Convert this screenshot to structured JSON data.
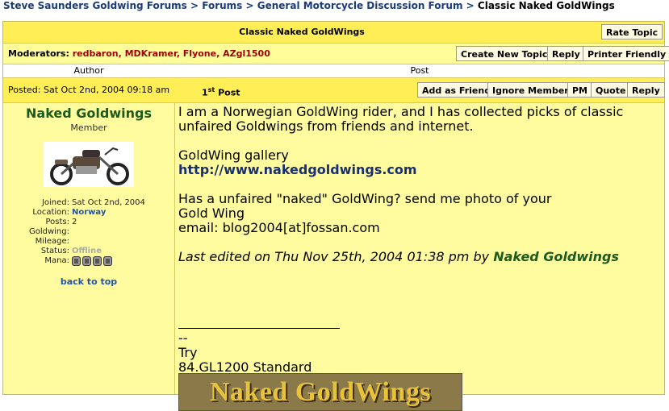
{
  "breadcrumb": {
    "items": [
      "Steve Saunders Goldwing Forums",
      "Forums",
      "General Motorcycle Discussion Forum"
    ],
    "separator": ">",
    "current": "Classic Naked GoldWings"
  },
  "topic": {
    "title": "Classic Naked GoldWings",
    "rate_button": "Rate Topic"
  },
  "moderators": {
    "label": "Moderators:",
    "names": "redbaron, MDKramer, Flyone, AZgl1500",
    "buttons": {
      "new_topic": "Create New Topic",
      "reply": "Reply",
      "printer": "Printer Friendly"
    }
  },
  "columns": {
    "author": "Author",
    "post": "Post"
  },
  "post": {
    "posted": "Posted: Sat Oct 2nd, 2004 09:18 am",
    "number": "1",
    "number_suffix": "st",
    "number_label": "Post",
    "buttons": {
      "add_friend": "Add as Friend",
      "ignore": "Ignore Member",
      "pm": "PM",
      "quote": "Quote",
      "reply": "Reply"
    },
    "message": {
      "line1": "I am a Norwegian GoldWing rider, and I has collected picks of classic unfaired Goldwings from friends and internet.",
      "gallery_label": "GoldWing gallery",
      "gallery_link": "http://www.nakedgoldwings.com",
      "line3a": "Has a unfaired \"naked\" GoldWing? send me photo of your",
      "line3b": "Gold Wing",
      "email": "email: blog2004[at]fossan.com",
      "edited_prefix": "Last edited on Thu Nov 25th, 2004 01:38 pm by",
      "edited_by": "Naked Goldwings"
    },
    "signature": {
      "dashes": "--",
      "line1": "Try",
      "line2": "84.GL1200 Standard",
      "banner_text": "Naked GoldWings"
    }
  },
  "author": {
    "name": "Naked Goldwings",
    "role": "Member",
    "stats": [
      {
        "key": "Joined:",
        "value": "Sat Oct 2nd, 2004",
        "style": ""
      },
      {
        "key": "Location:",
        "value": "Norway",
        "style": "blue"
      },
      {
        "key": "Posts:",
        "value": "2",
        "style": ""
      },
      {
        "key": "Goldwing:",
        "value": "",
        "style": ""
      },
      {
        "key": "Mileage:",
        "value": "",
        "style": ""
      },
      {
        "key": "Status:",
        "value": "Offline",
        "style": "grey"
      },
      {
        "key": "Mana:",
        "value": "",
        "style": "mana"
      }
    ],
    "back_to_top": "back to top"
  }
}
